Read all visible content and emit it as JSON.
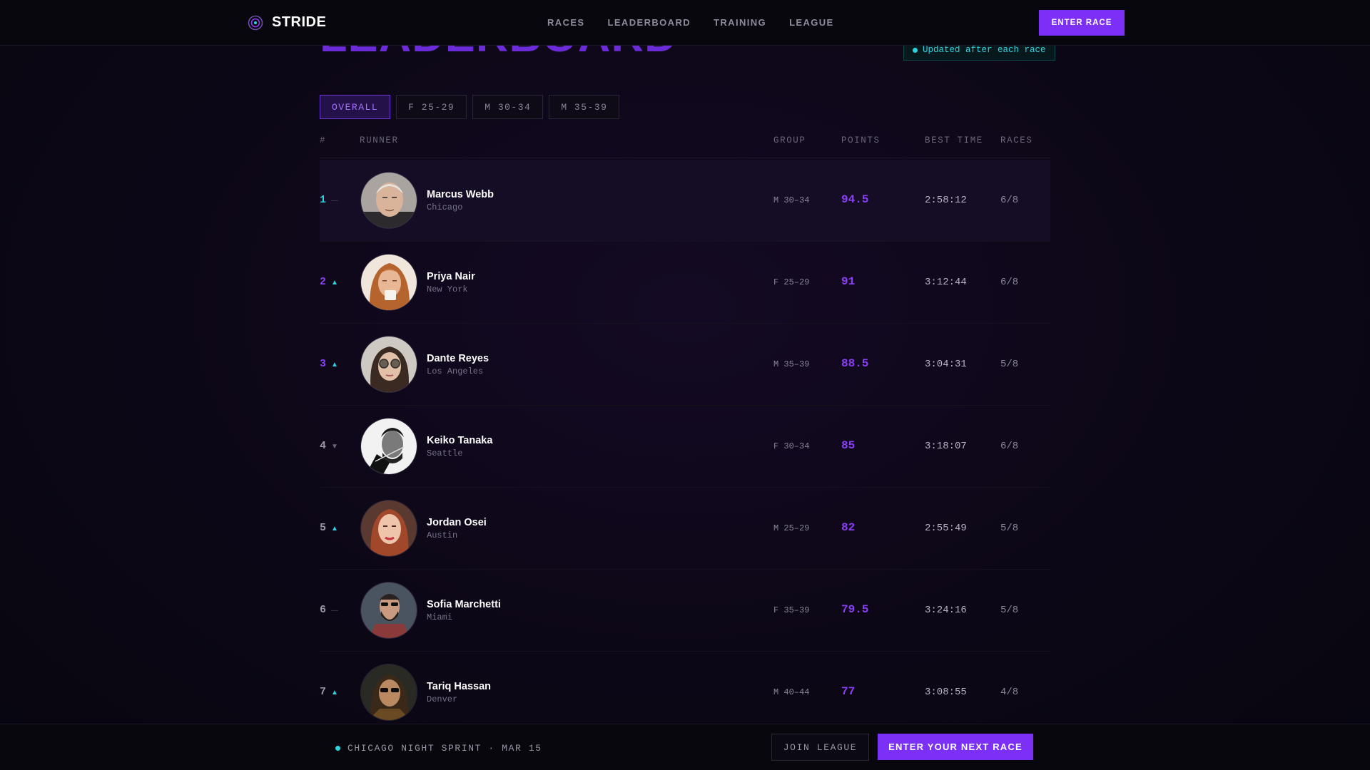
{
  "brand": {
    "name": "STRIDE",
    "icon": "target-icon"
  },
  "nav": [
    {
      "label": "RACES"
    },
    {
      "label": "LEADERBOARD"
    },
    {
      "label": "TRAINING"
    },
    {
      "label": "LEAGUE"
    }
  ],
  "header_cta": "ENTER RACE",
  "page_title": "LEADERBOARD",
  "update_badge": "Updated after each race",
  "tabs": [
    {
      "label": "OVERALL",
      "active": true
    },
    {
      "label": "F 25-29",
      "active": false
    },
    {
      "label": "M 30-34",
      "active": false
    },
    {
      "label": "M 35-39",
      "active": false
    }
  ],
  "columns": {
    "rank": "#",
    "runner": "RUNNER",
    "group": "GROUP",
    "points": "POINTS",
    "best_time": "BEST TIME",
    "races": "RACES"
  },
  "rows": [
    {
      "rank": "1",
      "trend": "flat",
      "name": "Marcus Webb",
      "city": "Chicago",
      "group": "M 30–34",
      "points": "94.5",
      "best_time": "2:58:12",
      "races": "6/8"
    },
    {
      "rank": "2",
      "trend": "up",
      "name": "Priya Nair",
      "city": "New York",
      "group": "F 25–29",
      "points": "91",
      "best_time": "3:12:44",
      "races": "6/8"
    },
    {
      "rank": "3",
      "trend": "up",
      "name": "Dante Reyes",
      "city": "Los Angeles",
      "group": "M 35–39",
      "points": "88.5",
      "best_time": "3:04:31",
      "races": "5/8"
    },
    {
      "rank": "4",
      "trend": "down",
      "name": "Keiko Tanaka",
      "city": "Seattle",
      "group": "F 30–34",
      "points": "85",
      "best_time": "3:18:07",
      "races": "6/8"
    },
    {
      "rank": "5",
      "trend": "up",
      "name": "Jordan Osei",
      "city": "Austin",
      "group": "M 25–29",
      "points": "82",
      "best_time": "2:55:49",
      "races": "5/8"
    },
    {
      "rank": "6",
      "trend": "flat",
      "name": "Sofia Marchetti",
      "city": "Miami",
      "group": "F 35–39",
      "points": "79.5",
      "best_time": "3:24:16",
      "races": "5/8"
    },
    {
      "rank": "7",
      "trend": "up",
      "name": "Tariq Hassan",
      "city": "Denver",
      "group": "M 40–44",
      "points": "77",
      "best_time": "3:08:55",
      "races": "4/8"
    }
  ],
  "trend_glyphs": {
    "up": "▲",
    "down": "▼",
    "flat": "—"
  },
  "footer": {
    "event": "CHICAGO NIGHT SPRINT · MAR 15",
    "join": "JOIN LEAGUE",
    "next": "ENTER YOUR NEXT RACE"
  },
  "colors": {
    "accent": "#7b2ff7",
    "cyan": "#2ed3e0",
    "background": "#0c0716"
  }
}
